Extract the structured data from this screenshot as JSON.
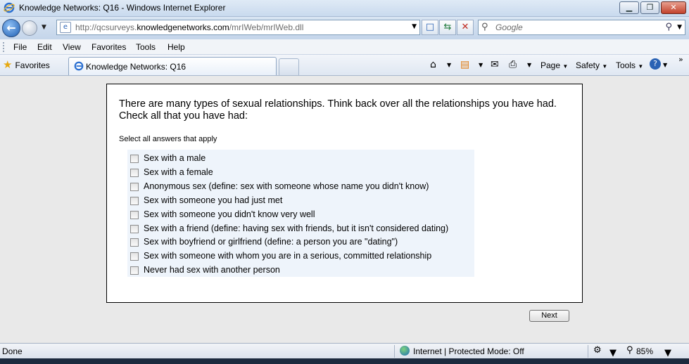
{
  "window": {
    "title": "Knowledge Networks: Q16 - Windows Internet Explorer",
    "controls": {
      "minimize": "▁",
      "maximize": "❐",
      "close": "✕"
    }
  },
  "address": {
    "url_prefix": "http://qcsurveys.",
    "url_domain": "knowledgenetworks.com",
    "url_path": "/mrIWeb/mrIWeb.dll"
  },
  "search": {
    "placeholder": "Google"
  },
  "menu": [
    "File",
    "Edit",
    "View",
    "Favorites",
    "Tools",
    "Help"
  ],
  "favorites_bar": {
    "favorites_label": "Favorites"
  },
  "tabs": [
    {
      "label": "Knowledge Networks: Q16"
    }
  ],
  "command_bar": {
    "page": "Page",
    "safety": "Safety",
    "tools": "Tools"
  },
  "survey": {
    "question": "There are many types of sexual relationships. Think back over all the relationships you have had. Check all that you have had:",
    "instruction": "Select all answers that apply",
    "options": [
      "Sex with a male",
      "Sex with a female",
      "Anonymous sex (define: sex with someone whose name you didn't know)",
      "Sex with someone you had just met",
      "Sex with someone you didn't know very well",
      "Sex with a friend (define: having sex with friends, but it isn't considered dating)",
      "Sex with boyfriend or girlfriend (define: a person you are \"dating\")",
      "Sex with someone with whom you are in a serious, committed relationship",
      "Never had sex with another person"
    ],
    "next_label": "Next"
  },
  "status": {
    "text": "Done",
    "zone": "Internet | Protected Mode: Off",
    "zoom": "85%"
  },
  "colors": {
    "accent": "#1f5fb3",
    "answer_bg": "#eef4fb"
  }
}
